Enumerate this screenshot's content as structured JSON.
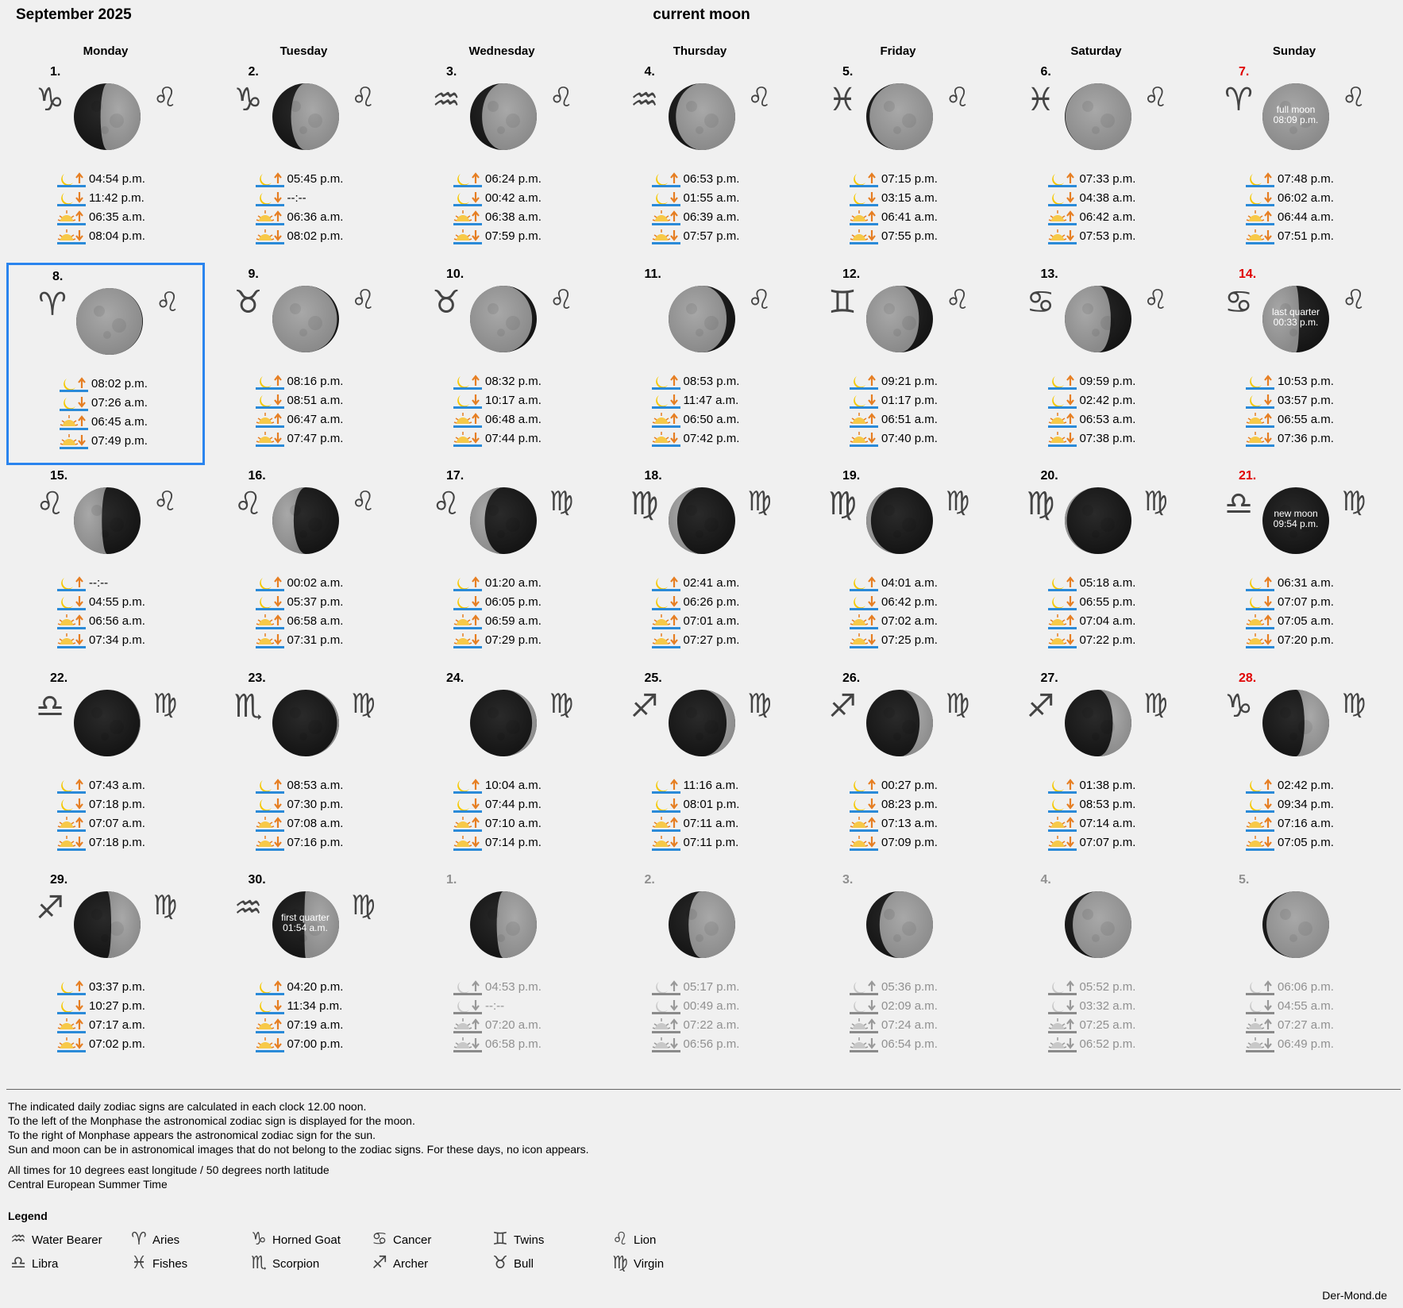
{
  "header": {
    "month": "September 2025",
    "current_moon_link": "current moon"
  },
  "weekdays": [
    "Monday",
    "Tuesday",
    "Wednesday",
    "Thursday",
    "Friday",
    "Saturday",
    "Sunday"
  ],
  "weeks": [
    [
      {
        "day": "1.",
        "moon_sign": "♑",
        "sun_sign": "♌",
        "illum": 0.6,
        "waxing": true,
        "times": [
          "04:54 p.m.",
          "11:42 p.m.",
          "06:35 a.m.",
          "08:04 p.m."
        ]
      },
      {
        "day": "2.",
        "moon_sign": "♑",
        "sun_sign": "♌",
        "illum": 0.72,
        "waxing": true,
        "times": [
          "05:45 p.m.",
          "--:--",
          "06:36 a.m.",
          "08:02 p.m."
        ]
      },
      {
        "day": "3.",
        "moon_sign": "♒",
        "sun_sign": "♌",
        "illum": 0.82,
        "waxing": true,
        "times": [
          "06:24 p.m.",
          "00:42 a.m.",
          "06:38 a.m.",
          "07:59 p.m."
        ]
      },
      {
        "day": "4.",
        "moon_sign": "♒",
        "sun_sign": "♌",
        "illum": 0.89,
        "waxing": true,
        "times": [
          "06:53 p.m.",
          "01:55 a.m.",
          "06:39 a.m.",
          "07:57 p.m."
        ]
      },
      {
        "day": "5.",
        "moon_sign": "♓",
        "sun_sign": "♌",
        "illum": 0.95,
        "waxing": true,
        "times": [
          "07:15 p.m.",
          "03:15 a.m.",
          "06:41 a.m.",
          "07:55 p.m."
        ]
      },
      {
        "day": "6.",
        "moon_sign": "♓",
        "sun_sign": "♌",
        "illum": 0.99,
        "waxing": true,
        "times": [
          "07:33 p.m.",
          "04:38 a.m.",
          "06:42 a.m.",
          "07:53 p.m."
        ]
      },
      {
        "day": "7.",
        "moon_sign": "♈",
        "sun_sign": "♌",
        "illum": 1.0,
        "waxing": true,
        "sunday": true,
        "phase": [
          "full moon",
          "08:09 p.m."
        ],
        "times": [
          "07:48 p.m.",
          "06:02 a.m.",
          "06:44 a.m.",
          "07:51 p.m."
        ]
      }
    ],
    [
      {
        "day": "8.",
        "moon_sign": "♈",
        "sun_sign": "♌",
        "illum": 0.99,
        "waxing": false,
        "today": true,
        "times": [
          "08:02 p.m.",
          "07:26 a.m.",
          "06:45 a.m.",
          "07:49 p.m."
        ]
      },
      {
        "day": "9.",
        "moon_sign": "♉",
        "sun_sign": "♌",
        "illum": 0.97,
        "waxing": false,
        "times": [
          "08:16 p.m.",
          "08:51 a.m.",
          "06:47 a.m.",
          "07:47 p.m."
        ]
      },
      {
        "day": "10.",
        "moon_sign": "♉",
        "sun_sign": "♌",
        "illum": 0.93,
        "waxing": false,
        "times": [
          "08:32 p.m.",
          "10:17 a.m.",
          "06:48 a.m.",
          "07:44 p.m."
        ]
      },
      {
        "day": "11.",
        "moon_sign": "",
        "sun_sign": "♌",
        "illum": 0.87,
        "waxing": false,
        "times": [
          "08:53 p.m.",
          "11:47 a.m.",
          "06:50 a.m.",
          "07:42 p.m."
        ]
      },
      {
        "day": "12.",
        "moon_sign": "♊",
        "sun_sign": "♌",
        "illum": 0.79,
        "waxing": false,
        "times": [
          "09:21 p.m.",
          "01:17 p.m.",
          "06:51 a.m.",
          "07:40 p.m."
        ]
      },
      {
        "day": "13.",
        "moon_sign": "♋",
        "sun_sign": "♌",
        "illum": 0.69,
        "waxing": false,
        "times": [
          "09:59 p.m.",
          "02:42 p.m.",
          "06:53 a.m.",
          "07:38 p.m."
        ]
      },
      {
        "day": "14.",
        "moon_sign": "♋",
        "sun_sign": "♌",
        "illum": 0.55,
        "waxing": false,
        "sunday": true,
        "phase": [
          "last quarter",
          "00:33 p.m."
        ],
        "times": [
          "10:53 p.m.",
          "03:57 p.m.",
          "06:55 a.m.",
          "07:36 p.m."
        ]
      }
    ],
    [
      {
        "day": "15.",
        "moon_sign": "♌",
        "sun_sign": "♌",
        "illum": 0.42,
        "waxing": false,
        "times": [
          "--:--",
          "04:55 p.m.",
          "06:56 a.m.",
          "07:34 p.m."
        ]
      },
      {
        "day": "16.",
        "moon_sign": "♌",
        "sun_sign": "♌",
        "illum": 0.32,
        "waxing": false,
        "times": [
          "00:02 a.m.",
          "05:37 p.m.",
          "06:58 a.m.",
          "07:31 p.m."
        ]
      },
      {
        "day": "17.",
        "moon_sign": "♌",
        "sun_sign": "♍",
        "illum": 0.22,
        "waxing": false,
        "times": [
          "01:20 a.m.",
          "06:05 p.m.",
          "06:59 a.m.",
          "07:29 p.m."
        ]
      },
      {
        "day": "18.",
        "moon_sign": "♍",
        "sun_sign": "♍",
        "illum": 0.13,
        "waxing": false,
        "times": [
          "02:41 a.m.",
          "06:26 p.m.",
          "07:01 a.m.",
          "07:27 p.m."
        ]
      },
      {
        "day": "19.",
        "moon_sign": "♍",
        "sun_sign": "♍",
        "illum": 0.07,
        "waxing": false,
        "times": [
          "04:01 a.m.",
          "06:42 p.m.",
          "07:02 a.m.",
          "07:25 p.m."
        ]
      },
      {
        "day": "20.",
        "moon_sign": "♍",
        "sun_sign": "♍",
        "illum": 0.03,
        "waxing": false,
        "times": [
          "05:18 a.m.",
          "06:55 p.m.",
          "07:04 a.m.",
          "07:22 p.m."
        ]
      },
      {
        "day": "21.",
        "moon_sign": "♎",
        "sun_sign": "♍",
        "illum": 0.0,
        "waxing": true,
        "sunday": true,
        "phase": [
          "new moon",
          "09:54 p.m."
        ],
        "times": [
          "06:31 a.m.",
          "07:07 p.m.",
          "07:05 a.m.",
          "07:20 p.m."
        ]
      }
    ],
    [
      {
        "day": "22.",
        "moon_sign": "♎",
        "sun_sign": "♍",
        "illum": 0.01,
        "waxing": true,
        "times": [
          "07:43 a.m.",
          "07:18 p.m.",
          "07:07 a.m.",
          "07:18 p.m."
        ]
      },
      {
        "day": "23.",
        "moon_sign": "♏",
        "sun_sign": "♍",
        "illum": 0.03,
        "waxing": true,
        "times": [
          "08:53 a.m.",
          "07:30 p.m.",
          "07:08 a.m.",
          "07:16 p.m."
        ]
      },
      {
        "day": "24.",
        "moon_sign": "",
        "sun_sign": "♍",
        "illum": 0.07,
        "waxing": true,
        "times": [
          "10:04 a.m.",
          "07:44 p.m.",
          "07:10 a.m.",
          "07:14 p.m."
        ]
      },
      {
        "day": "25.",
        "moon_sign": "♐",
        "sun_sign": "♍",
        "illum": 0.13,
        "waxing": true,
        "times": [
          "11:16 a.m.",
          "08:01 p.m.",
          "07:11 a.m.",
          "07:11 p.m."
        ]
      },
      {
        "day": "26.",
        "moon_sign": "♐",
        "sun_sign": "♍",
        "illum": 0.2,
        "waxing": true,
        "times": [
          "00:27 p.m.",
          "08:23 p.m.",
          "07:13 a.m.",
          "07:09 p.m."
        ]
      },
      {
        "day": "27.",
        "moon_sign": "♐",
        "sun_sign": "♍",
        "illum": 0.28,
        "waxing": true,
        "times": [
          "01:38 p.m.",
          "08:53 p.m.",
          "07:14 a.m.",
          "07:07 p.m."
        ]
      },
      {
        "day": "28.",
        "moon_sign": "♑",
        "sun_sign": "♍",
        "illum": 0.37,
        "waxing": true,
        "sunday": true,
        "times": [
          "02:42 p.m.",
          "09:34 p.m.",
          "07:16 a.m.",
          "07:05 p.m."
        ]
      }
    ],
    [
      {
        "day": "29.",
        "moon_sign": "♐",
        "sun_sign": "♍",
        "illum": 0.44,
        "waxing": true,
        "times": [
          "03:37 p.m.",
          "10:27 p.m.",
          "07:17 a.m.",
          "07:02 p.m."
        ]
      },
      {
        "day": "30.",
        "moon_sign": "♒",
        "sun_sign": "♍",
        "illum": 0.52,
        "waxing": true,
        "phase": [
          "first quarter",
          "01:54 a.m."
        ],
        "times": [
          "04:20 p.m.",
          "11:34 p.m.",
          "07:19 a.m.",
          "07:00 p.m."
        ]
      },
      {
        "day": "1.",
        "moon_sign": "",
        "sun_sign": "",
        "illum": 0.6,
        "waxing": true,
        "outside": true,
        "times": [
          "04:53 p.m.",
          "--:--",
          "07:20 a.m.",
          "06:58 p.m."
        ]
      },
      {
        "day": "2.",
        "moon_sign": "",
        "sun_sign": "",
        "illum": 0.7,
        "waxing": true,
        "outside": true,
        "times": [
          "05:17 p.m.",
          "00:49 a.m.",
          "07:22 a.m.",
          "06:56 p.m."
        ]
      },
      {
        "day": "3.",
        "moon_sign": "",
        "sun_sign": "",
        "illum": 0.8,
        "waxing": true,
        "outside": true,
        "times": [
          "05:36 p.m.",
          "02:09 a.m.",
          "07:24 a.m.",
          "06:54 p.m."
        ]
      },
      {
        "day": "4.",
        "moon_sign": "",
        "sun_sign": "",
        "illum": 0.88,
        "waxing": true,
        "outside": true,
        "times": [
          "05:52 p.m.",
          "03:32 a.m.",
          "07:25 a.m.",
          "06:52 p.m."
        ]
      },
      {
        "day": "5.",
        "moon_sign": "",
        "sun_sign": "",
        "illum": 0.94,
        "waxing": true,
        "outside": true,
        "times": [
          "06:06 p.m.",
          "04:55 a.m.",
          "07:27 a.m.",
          "06:49 p.m."
        ]
      }
    ]
  ],
  "notes": [
    "The indicated daily zodiac signs are calculated in each clock 12.00 noon.",
    "To the left of the Monphase the astronomical zodiac sign is displayed for the moon.",
    "To the right of Monphase appears the astronomical zodiac sign for the sun.",
    "Sun and moon can be in astronomical images that do not belong to the zodiac signs. For these days, no icon appears."
  ],
  "location_notes": [
    "All times for 10 degrees east longitude / 50 degrees north latitude",
    "Central European Summer Time"
  ],
  "legend": {
    "title": "Legend",
    "items": [
      {
        "icon": "♒",
        "label": "Water Bearer",
        "name": "water-bearer-icon"
      },
      {
        "icon": "♈",
        "label": "Aries",
        "name": "aries-icon"
      },
      {
        "icon": "♑",
        "label": "Horned Goat",
        "name": "horned-goat-icon"
      },
      {
        "icon": "♋",
        "label": "Cancer",
        "name": "cancer-icon"
      },
      {
        "icon": "♊",
        "label": "Twins",
        "name": "twins-icon"
      },
      {
        "icon": "♌",
        "label": "Lion",
        "name": "lion-icon"
      },
      {
        "icon": "♎",
        "label": "Libra",
        "name": "libra-icon"
      },
      {
        "icon": "♓",
        "label": "Fishes",
        "name": "fishes-icon"
      },
      {
        "icon": "♏",
        "label": "Scorpion",
        "name": "scorpion-icon"
      },
      {
        "icon": "♐",
        "label": "Archer",
        "name": "archer-icon"
      },
      {
        "icon": "♉",
        "label": "Bull",
        "name": "bull-icon"
      },
      {
        "icon": "♍",
        "label": "Virgin",
        "name": "virgin-icon"
      }
    ]
  },
  "footer": {
    "brand": "Der-Mond.de"
  },
  "colors": {
    "today_border": "#2a84ee",
    "sunday": "#e00000",
    "outside": "#909090",
    "arrow": "#e67e22",
    "line": "#2a8ad8",
    "moon_yellow": "#f5c800"
  }
}
